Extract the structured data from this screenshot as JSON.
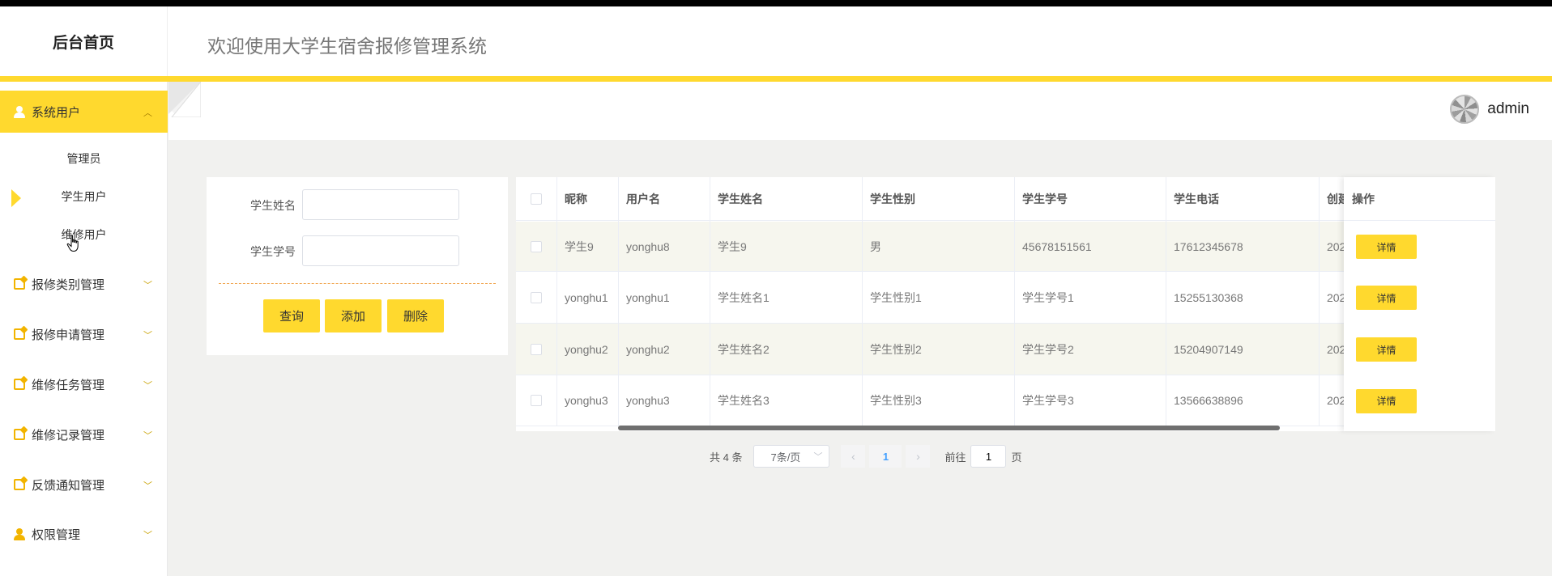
{
  "header": {
    "brand": "后台首页",
    "title": "欢迎使用大学生宿舍报修管理系统"
  },
  "user": {
    "name": "admin"
  },
  "sidebar": {
    "groups": [
      {
        "label": "系统用户",
        "icon": "user-icon",
        "expanded": true,
        "children": [
          {
            "label": "管理员"
          },
          {
            "label": "学生用户"
          },
          {
            "label": "维修用户"
          }
        ]
      },
      {
        "label": "报修类别管理",
        "icon": "edit-icon"
      },
      {
        "label": "报修申请管理",
        "icon": "edit-icon"
      },
      {
        "label": "维修任务管理",
        "icon": "edit-icon"
      },
      {
        "label": "维修记录管理",
        "icon": "edit-icon"
      },
      {
        "label": "反馈通知管理",
        "icon": "edit-icon"
      },
      {
        "label": "权限管理",
        "icon": "user-icon"
      }
    ]
  },
  "search": {
    "name_label": "学生姓名",
    "number_label": "学生学号",
    "name_value": "",
    "number_value": "",
    "query_button": "查询",
    "add_button": "添加",
    "delete_button": "删除"
  },
  "table": {
    "columns": [
      "昵称",
      "用户名",
      "学生姓名",
      "学生性别",
      "学生学号",
      "学生电话",
      "创建",
      "操作"
    ],
    "rows": [
      {
        "nickname": "学生9",
        "username": "yonghu8",
        "name": "学生9",
        "gender": "男",
        "number": "45678151561",
        "phone": "17612345678",
        "created": "202",
        "action": "详情"
      },
      {
        "nickname": "yonghu1",
        "username": "yonghu1",
        "name": "学生姓名1",
        "gender": "学生性别1",
        "number": "学生学号1",
        "phone": "15255130368",
        "created": "202",
        "action": "详情"
      },
      {
        "nickname": "yonghu2",
        "username": "yonghu2",
        "name": "学生姓名2",
        "gender": "学生性别2",
        "number": "学生学号2",
        "phone": "15204907149",
        "created": "202",
        "action": "详情"
      },
      {
        "nickname": "yonghu3",
        "username": "yonghu3",
        "name": "学生姓名3",
        "gender": "学生性别3",
        "number": "学生学号3",
        "phone": "13566638896",
        "created": "202",
        "action": "详情"
      }
    ]
  },
  "pagination": {
    "total": "共 4 条",
    "page_size": "7条/页",
    "current_page": "1",
    "goto_label": "前往",
    "goto_value": "1",
    "page_suffix": "页",
    "prev_glyph": "‹",
    "next_glyph": "›"
  },
  "colors": {
    "accent": "#ffd92e",
    "header_bg": "#ffffff",
    "content_bg": "#f1f1ef"
  }
}
